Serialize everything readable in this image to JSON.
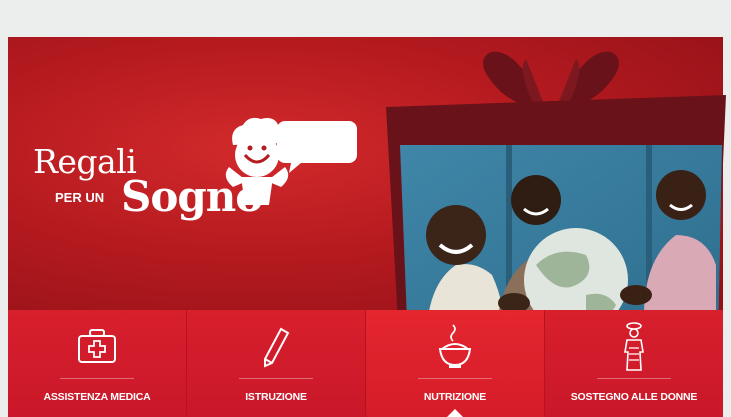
{
  "logo": {
    "line1": "Regali",
    "line2_small": "PER UN",
    "line2_big": "Sogno"
  },
  "tabs": [
    {
      "label": "ASSISTENZA MEDICA",
      "icon": "medical-kit-icon"
    },
    {
      "label": "ISTRUZIONE",
      "icon": "pencil-icon"
    },
    {
      "label": "NUTRIZIONE",
      "icon": "food-bowl-icon",
      "active": true
    },
    {
      "label": "SOSTEGNO ALLE DONNE",
      "icon": "woman-carrying-icon"
    }
  ],
  "colors": {
    "page_bg": "#eceeed",
    "banner_red": "#b51a1f",
    "tab_red": "#d81f2c",
    "gift_dark": "#6a1219"
  }
}
